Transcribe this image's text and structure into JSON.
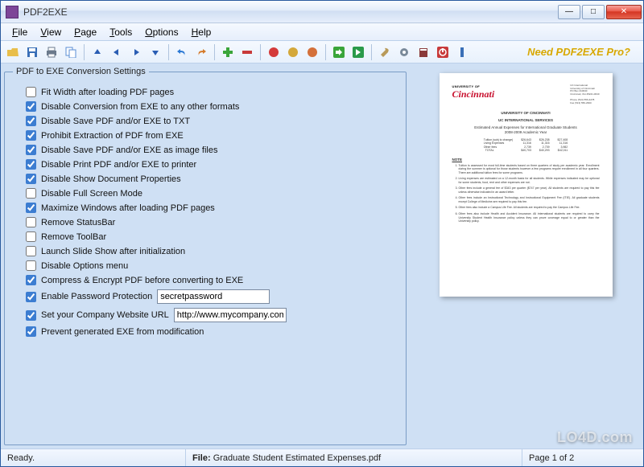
{
  "window": {
    "title": "PDF2EXE"
  },
  "menu": {
    "file": "File",
    "view": "View",
    "page": "Page",
    "tools": "Tools",
    "options": "Options",
    "help": "Help"
  },
  "promo": "Need PDF2EXE Pro?",
  "settings": {
    "legend": "PDF to EXE Conversion Settings",
    "items": [
      {
        "label": "Fit Width after loading PDF pages",
        "checked": false
      },
      {
        "label": "Disable Conversion from EXE to any other formats",
        "checked": true
      },
      {
        "label": "Disable Save PDF and/or EXE to TXT",
        "checked": true
      },
      {
        "label": "Prohibit Extraction of PDF from EXE",
        "checked": true
      },
      {
        "label": "Disable Save PDF and/or EXE as image files",
        "checked": true
      },
      {
        "label": "Disable Print PDF and/or EXE to printer",
        "checked": true
      },
      {
        "label": "Disable Show Document Properties",
        "checked": true
      },
      {
        "label": "Disable Full Screen Mode",
        "checked": false
      },
      {
        "label": "Maximize Windows after loading PDF pages",
        "checked": true
      },
      {
        "label": "Remove StatusBar",
        "checked": false
      },
      {
        "label": "Remove ToolBar",
        "checked": false
      },
      {
        "label": "Launch Slide Show after initialization",
        "checked": false
      },
      {
        "label": "Disable Options menu",
        "checked": false
      },
      {
        "label": "Compress & Encrypt PDF before converting to EXE",
        "checked": true
      },
      {
        "label": "Enable Password Protection",
        "checked": true,
        "input": "secretpassword"
      },
      {
        "label": "Set your Company Website URL",
        "checked": true,
        "input": "http://www.mycompany.com"
      },
      {
        "label": "Prevent generated EXE from modification",
        "checked": true
      }
    ]
  },
  "preview": {
    "logo_top": "UNIVERSITY OF",
    "logo_main": "Cincinnati",
    "header1": "UNIVERSITY OF CINCINNATI",
    "header2": "UC INTERNATIONAL SERVICES",
    "subtitle": "Estimated Annual Expenses for International Graduate Students\n2008-2009 Academic Year",
    "note": "NOTE"
  },
  "status": {
    "ready": "Ready.",
    "file_label": "File:",
    "file_name": "Graduate Student Estimated Expenses.pdf",
    "page": "Page 1 of 2"
  },
  "toolbar_icons": [
    "open-icon",
    "save-icon",
    "print-icon",
    "copy-icon",
    "sep",
    "up-icon",
    "left-icon",
    "right-icon",
    "down-icon",
    "sep",
    "undo-icon",
    "redo-icon",
    "sep",
    "add-icon",
    "remove-icon",
    "sep",
    "stop-red-icon",
    "stop-yellow-icon",
    "stop-orange-icon",
    "sep",
    "play-green-icon",
    "go-icon",
    "sep",
    "wrench-icon",
    "gear-icon",
    "book-icon",
    "power-icon",
    "info-icon"
  ],
  "icon_colors": {
    "open-icon": "#e8be4a",
    "save-icon": "#3a6fb7",
    "print-icon": "#6b7a8c",
    "copy-icon": "#5a8ed4",
    "up-icon": "#2a5db3",
    "left-icon": "#2a5db3",
    "right-icon": "#2a5db3",
    "down-icon": "#2a5db3",
    "undo-icon": "#2a78d4",
    "redo-icon": "#d47a2a",
    "add-icon": "#3aa53a",
    "remove-icon": "#c83a3a",
    "stop-red-icon": "#d43a3a",
    "stop-yellow-icon": "#d4a83a",
    "stop-orange-icon": "#d4703a",
    "play-green-icon": "#3aa53a",
    "go-icon": "#2a9a4a",
    "wrench-icon": "#b89a5a",
    "gear-icon": "#7a8a9a",
    "book-icon": "#8a3a3a",
    "power-icon": "#c83a3a",
    "info-icon": "#3a6fb7"
  },
  "watermark": "LO4D.com"
}
